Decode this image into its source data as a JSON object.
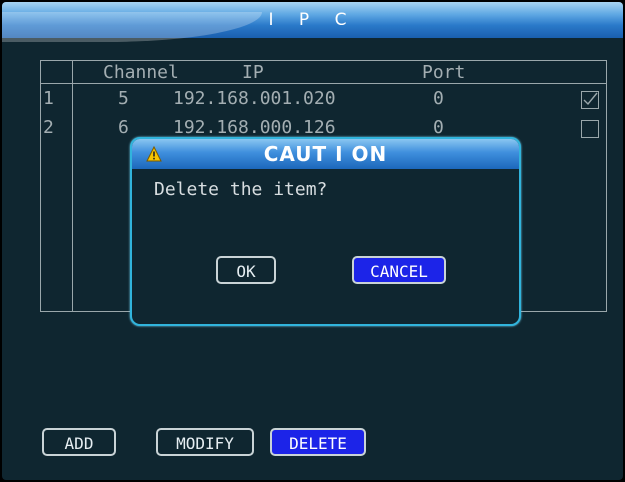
{
  "title": "I P C",
  "table": {
    "headers": {
      "channel": "Channel",
      "ip": "IP",
      "port": "Port"
    },
    "rows": [
      {
        "index": "1",
        "channel": "5",
        "ip": "192.168.001.020",
        "port": "0",
        "checked": true
      },
      {
        "index": "2",
        "channel": "6",
        "ip": "192.168.000.126",
        "port": "0",
        "checked": false
      }
    ]
  },
  "dialog": {
    "title": "CAUT I ON",
    "message": "Delete the item?",
    "ok_label": "OK",
    "cancel_label": "CANCEL"
  },
  "buttons": {
    "add_label": "ADD",
    "modify_label": "MODIFY",
    "delete_label": "DELETE"
  },
  "colors": {
    "background": "#0f2630",
    "accent_blue": "#1c24e8",
    "dialog_border": "#31b4dc",
    "warning": "#f5c400"
  },
  "icons": {
    "dialog_icon": "warning-icon",
    "row_check": "checkmark-icon"
  }
}
